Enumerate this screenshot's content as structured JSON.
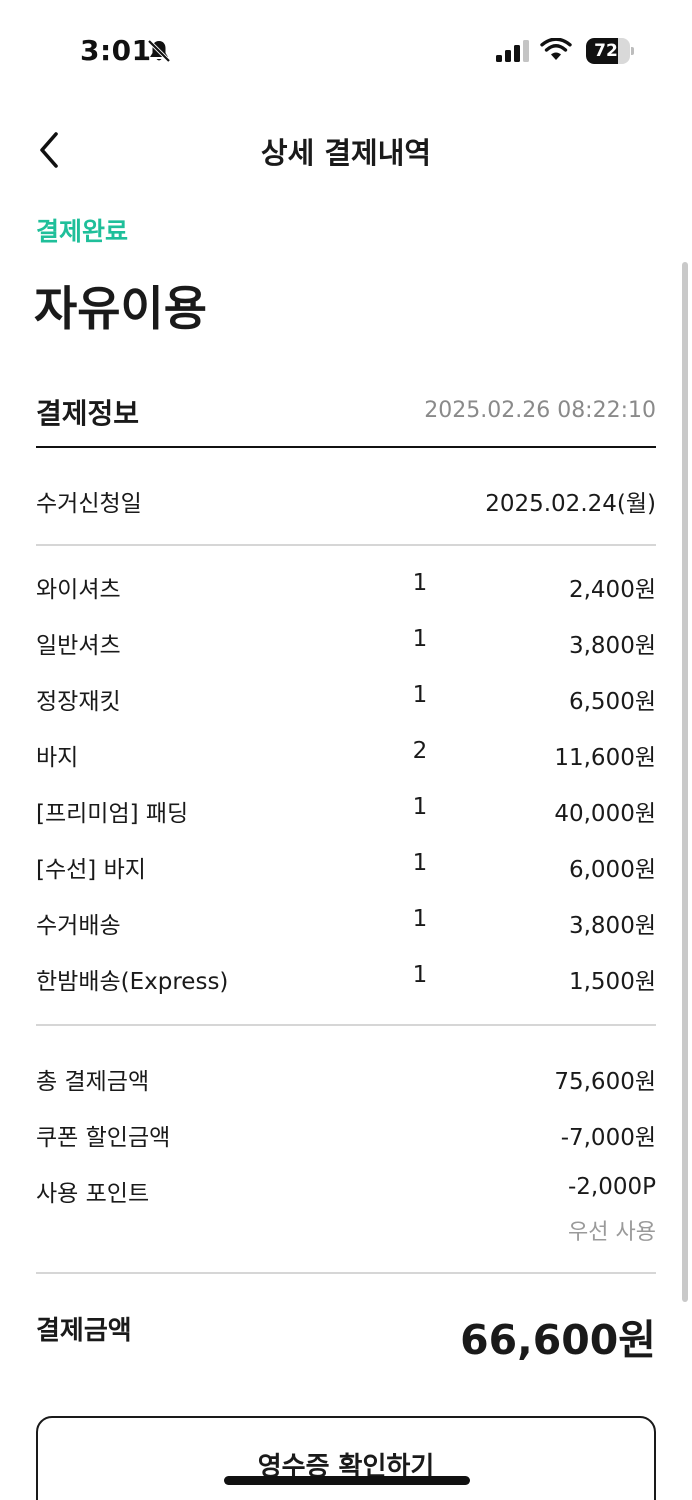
{
  "status_bar": {
    "time": "3:01",
    "battery_level": "72",
    "battery_fraction": 0.72,
    "icons": [
      "bell-slash-icon",
      "cellular-signal-icon",
      "wifi-icon",
      "battery-icon"
    ]
  },
  "header": {
    "title": "상세 결제내역",
    "back_icon": "chevron-left-icon"
  },
  "status_label": "결제완료",
  "service_title": "자유이용",
  "payment_info": {
    "title": "결제정보",
    "datetime": "2025.02.26 08:22:10",
    "pickup_label": "수거신청일",
    "pickup_date": "2025.02.24(월)"
  },
  "items": [
    {
      "name": "와이셔츠",
      "qty": "1",
      "price": "2,400원"
    },
    {
      "name": "일반셔츠",
      "qty": "1",
      "price": "3,800원"
    },
    {
      "name": "정장재킷",
      "qty": "1",
      "price": "6,500원"
    },
    {
      "name": "바지",
      "qty": "2",
      "price": "11,600원"
    },
    {
      "name": "[프리미엄] 패딩",
      "qty": "1",
      "price": "40,000원"
    },
    {
      "name": "[수선] 바지",
      "qty": "1",
      "price": "6,000원"
    },
    {
      "name": "수거배송",
      "qty": "1",
      "price": "3,800원"
    },
    {
      "name": "한밤배송(Express)",
      "qty": "1",
      "price": "1,500원"
    }
  ],
  "summary": {
    "total_label": "총 결제금액",
    "total_value": "75,600원",
    "coupon_label": "쿠폰 할인금액",
    "coupon_value": "-7,000원",
    "points_label": "사용 포인트",
    "points_value": "-2,000P",
    "points_note": "우선 사용"
  },
  "final": {
    "label": "결제금액",
    "value": "66,600원"
  },
  "receipt_button": "영수증 확인하기",
  "colors": {
    "accent": "#1fbf9a",
    "text": "#1a1a1a",
    "muted": "#8a8a8a",
    "divider": "#d6d6d6"
  }
}
